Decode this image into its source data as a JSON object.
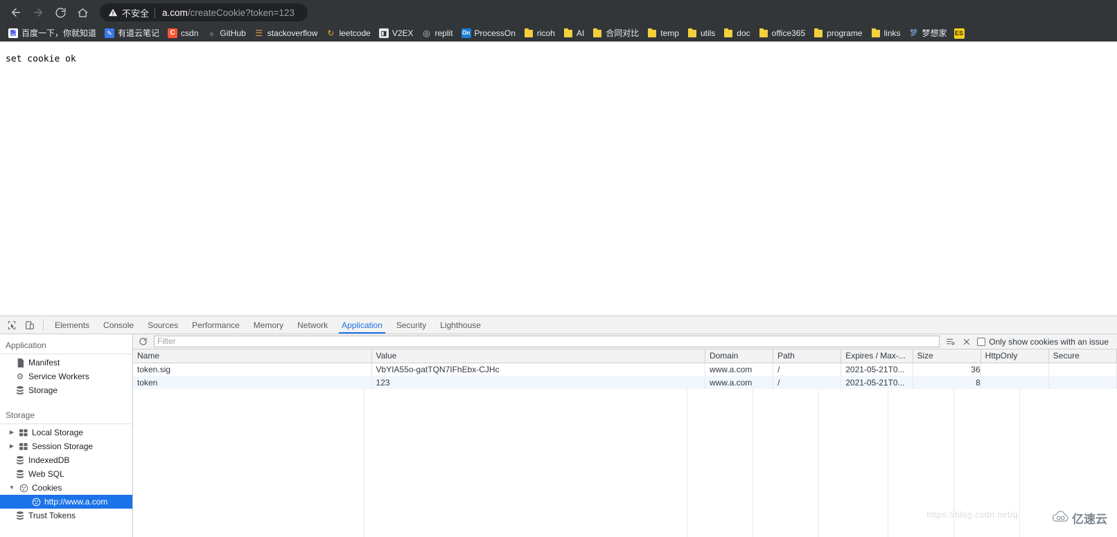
{
  "browser": {
    "nav": {
      "back_icon": "arrow-left-icon",
      "forward_icon": "arrow-right-icon",
      "reload_icon": "reload-icon",
      "home_icon": "home-icon"
    },
    "omnibox": {
      "warning_icon": "warning-triangle-icon",
      "security_label": "不安全",
      "url_host": "a.com",
      "url_path": "/createCookie?token=123",
      "full_url": "a.com/createCookie?token=123"
    },
    "bookmarks": [
      {
        "label": "百度一下，你就知道",
        "icon": "baidu-icon",
        "icon_type": "baidu"
      },
      {
        "label": "有道云笔记",
        "icon": "youdao-icon",
        "icon_type": "youdao"
      },
      {
        "label": "csdn",
        "icon": "csdn-icon",
        "icon_type": "csdn"
      },
      {
        "label": "GitHub",
        "icon": "github-icon",
        "icon_type": "github"
      },
      {
        "label": "stackoverflow",
        "icon": "stackoverflow-icon",
        "icon_type": "stackoverflow"
      },
      {
        "label": "leetcode",
        "icon": "leetcode-icon",
        "icon_type": "leetcode"
      },
      {
        "label": "V2EX",
        "icon": "v2ex-icon",
        "icon_type": "v2ex"
      },
      {
        "label": "replit",
        "icon": "replit-icon",
        "icon_type": "replit"
      },
      {
        "label": "ProcessOn",
        "icon": "processon-icon",
        "icon_type": "processon"
      },
      {
        "label": "ricoh",
        "icon": "folder-icon",
        "icon_type": "folder"
      },
      {
        "label": "AI",
        "icon": "folder-icon",
        "icon_type": "folder"
      },
      {
        "label": "合同对比",
        "icon": "folder-icon",
        "icon_type": "folder"
      },
      {
        "label": "temp",
        "icon": "folder-icon",
        "icon_type": "folder"
      },
      {
        "label": "utils",
        "icon": "folder-icon",
        "icon_type": "folder"
      },
      {
        "label": "doc",
        "icon": "folder-icon",
        "icon_type": "folder"
      },
      {
        "label": "office365",
        "icon": "folder-icon",
        "icon_type": "folder"
      },
      {
        "label": "programe",
        "icon": "folder-icon",
        "icon_type": "folder"
      },
      {
        "label": "links",
        "icon": "folder-icon",
        "icon_type": "folder"
      },
      {
        "label": "梦想家",
        "icon": "dream-icon",
        "icon_type": "dream"
      }
    ],
    "bookmarks_overflow_label": "ES"
  },
  "page": {
    "body_text": "set cookie ok"
  },
  "devtools": {
    "inspect_icon": "inspect-element-icon",
    "device_toolbar_icon": "device-toggle-icon",
    "tabs": [
      {
        "label": "Elements",
        "active": false
      },
      {
        "label": "Console",
        "active": false
      },
      {
        "label": "Sources",
        "active": false
      },
      {
        "label": "Performance",
        "active": false
      },
      {
        "label": "Memory",
        "active": false
      },
      {
        "label": "Network",
        "active": false
      },
      {
        "label": "Application",
        "active": true
      },
      {
        "label": "Security",
        "active": false
      },
      {
        "label": "Lighthouse",
        "active": false
      }
    ],
    "sidebar": {
      "application": {
        "title": "Application",
        "items": [
          {
            "label": "Manifest",
            "icon": "manifest-file-icon",
            "icon_type": "file",
            "level": 1,
            "twisty": "",
            "selected": false
          },
          {
            "label": "Service Workers",
            "icon": "gear-icon",
            "icon_type": "gear",
            "level": 1,
            "twisty": "",
            "selected": false
          },
          {
            "label": "Storage",
            "icon": "database-icon",
            "icon_type": "db",
            "level": 1,
            "twisty": "",
            "selected": false
          }
        ]
      },
      "storage": {
        "title": "Storage",
        "items": [
          {
            "label": "Local Storage",
            "icon": "table-grid-icon",
            "icon_type": "grid",
            "level": 2,
            "twisty": "▶",
            "selected": false
          },
          {
            "label": "Session Storage",
            "icon": "table-grid-icon",
            "icon_type": "grid",
            "level": 2,
            "twisty": "▶",
            "selected": false
          },
          {
            "label": "IndexedDB",
            "icon": "database-icon",
            "icon_type": "db",
            "level": 1,
            "twisty": "",
            "selected": false
          },
          {
            "label": "Web SQL",
            "icon": "database-icon",
            "icon_type": "db",
            "level": 1,
            "twisty": "",
            "selected": false
          },
          {
            "label": "Cookies",
            "icon": "cookie-icon",
            "icon_type": "cookie",
            "level": 2,
            "twisty": "▼",
            "selected": false
          },
          {
            "label": "http://www.a.com",
            "icon": "cookie-icon",
            "icon_type": "cookie",
            "level": 3,
            "twisty": "",
            "selected": true
          },
          {
            "label": "Trust Tokens",
            "icon": "database-icon",
            "icon_type": "db",
            "level": 1,
            "twisty": "",
            "selected": false
          }
        ]
      }
    },
    "cookies_panel": {
      "refresh_icon": "refresh-icon",
      "filter_placeholder": "Filter",
      "filter_value": "",
      "filter_options_icon": "filter-options-icon",
      "clear_icon": "clear-x-icon",
      "issue_checkbox_label": "Only show cookies with an issue",
      "issue_checkbox_checked": false,
      "columns": [
        "Name",
        "Value",
        "Domain",
        "Path",
        "Expires / Max-...",
        "Size",
        "HttpOnly",
        "Secure"
      ],
      "rows": [
        {
          "name": "token.sig",
          "value": "VbYIA55o-gatTQN7IFhEbx-CJHc",
          "domain": "www.a.com",
          "path": "/",
          "expires": "2021-05-21T0...",
          "size": "36",
          "httponly": "",
          "secure": ""
        },
        {
          "name": "token",
          "value": "123",
          "domain": "www.a.com",
          "path": "/",
          "expires": "2021-05-21T0...",
          "size": "8",
          "httponly": "",
          "secure": ""
        }
      ]
    }
  },
  "watermarks": {
    "csdn": "https://blog.csdn.net/q",
    "yisuyun": "亿速云"
  },
  "colors": {
    "chrome_bg": "#323639",
    "omnibox_bg": "#202124",
    "accent": "#1a73e8",
    "row_alt": "#f2f7fd",
    "folder_yellow": "#f4d03f"
  }
}
